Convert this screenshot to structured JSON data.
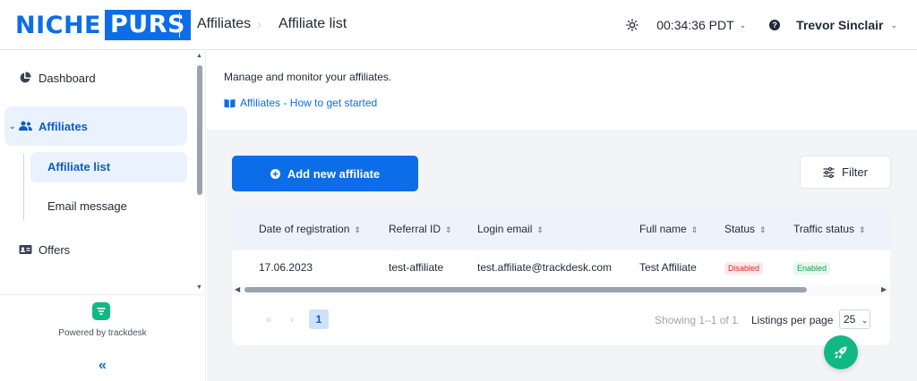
{
  "brand": {
    "part1": "NICHE",
    "part2": "PURS",
    "color": "#0b6ee8"
  },
  "breadcrumb": {
    "root": "Affiliates",
    "current": "Affiliate list"
  },
  "header": {
    "time": "00:34:36 PDT",
    "help": "?",
    "user": "Trevor Sinclair"
  },
  "sidebar": {
    "items": [
      {
        "label": "Dashboard",
        "icon": "pie-chart-icon"
      },
      {
        "label": "Affiliates",
        "icon": "users-icon"
      },
      {
        "label": "Offers",
        "icon": "id-card-icon"
      }
    ],
    "subitems": [
      "Affiliate list",
      "Email message"
    ],
    "powered_by": "Powered by trackdesk",
    "collapse": "«"
  },
  "intro": {
    "text": "Manage and monitor your affiliates.",
    "link": "Affiliates - How to get started"
  },
  "actions": {
    "add": "Add new affiliate",
    "filter": "Filter"
  },
  "table": {
    "columns": [
      "Date of registration",
      "Referral ID",
      "Login email",
      "Full name",
      "Status",
      "Traffic status"
    ],
    "rows": [
      {
        "date": "17.06.2023",
        "referral_id": "test-affiliate",
        "email": "test.affiliate@trackdesk.com",
        "full_name": "Test Affiliate",
        "status": "Disabled",
        "traffic_status": "Enabled"
      }
    ]
  },
  "pagination": {
    "first": "«",
    "prev": "‹",
    "page": "1",
    "showing": "Showing 1–1 of 1",
    "listings_label": "Listings per page",
    "per_page": "25"
  }
}
